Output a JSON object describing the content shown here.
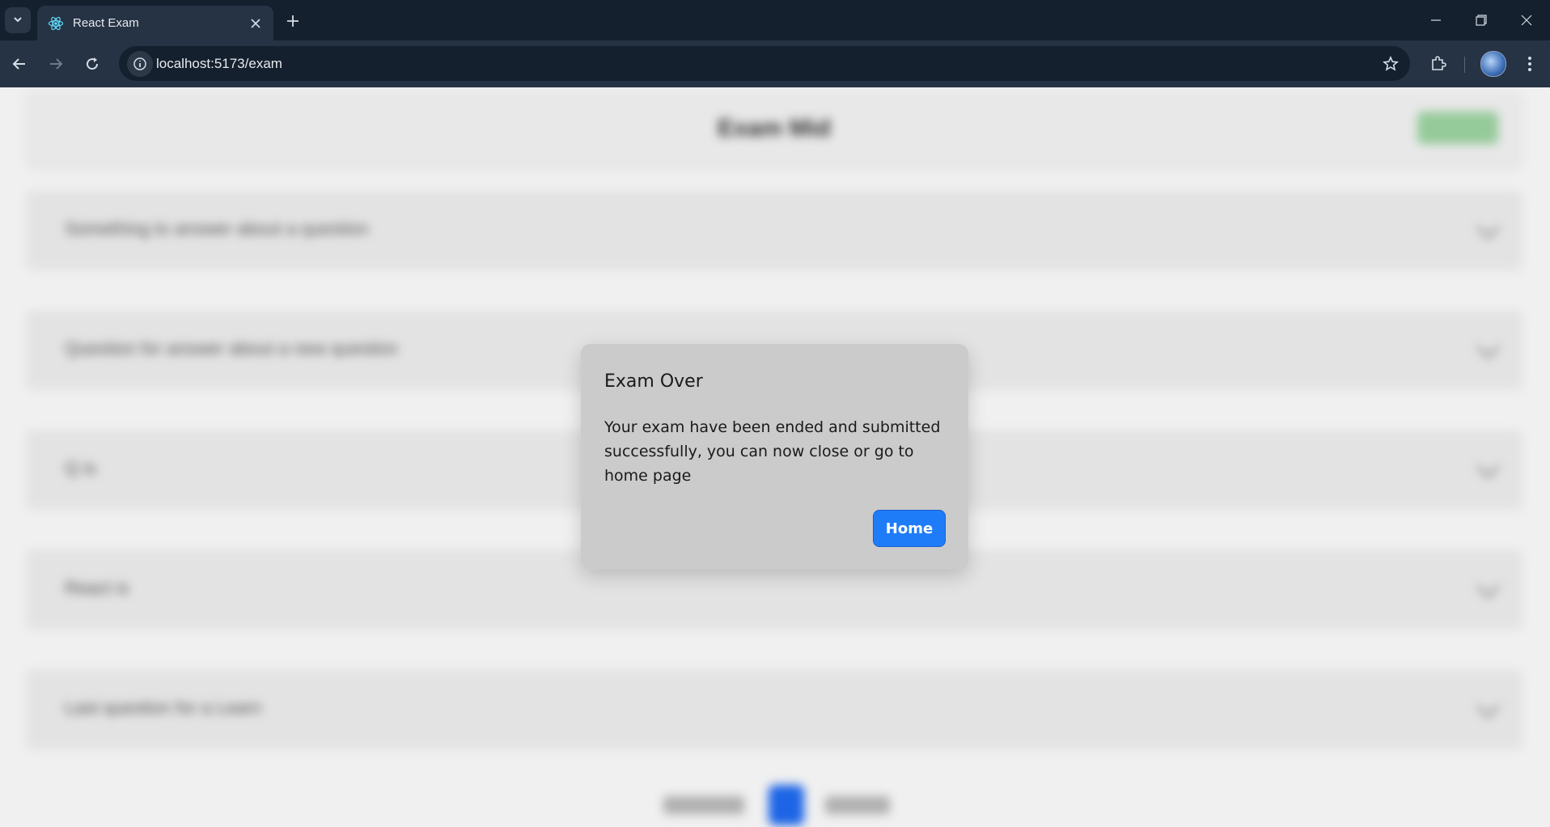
{
  "browser": {
    "tab_title": "React Exam",
    "url": "localhost:5173/exam"
  },
  "page": {
    "header_title": "Exam Mid",
    "questions": [
      {
        "text": "Something to answer about a question"
      },
      {
        "text": "Question for answer about a new question"
      },
      {
        "text": "Q is"
      },
      {
        "text": "React is"
      },
      {
        "text": "Last question for a Learn"
      }
    ]
  },
  "modal": {
    "title": "Exam Over",
    "message": "Your exam have been ended and submitted successfully, you can now close or go to home page",
    "home_button": "Home"
  },
  "colors": {
    "accent": "#1f7cf8",
    "chrome_dark": "#15202e",
    "chrome_mid": "#263344",
    "modal_bg": "#cbcbcb"
  }
}
